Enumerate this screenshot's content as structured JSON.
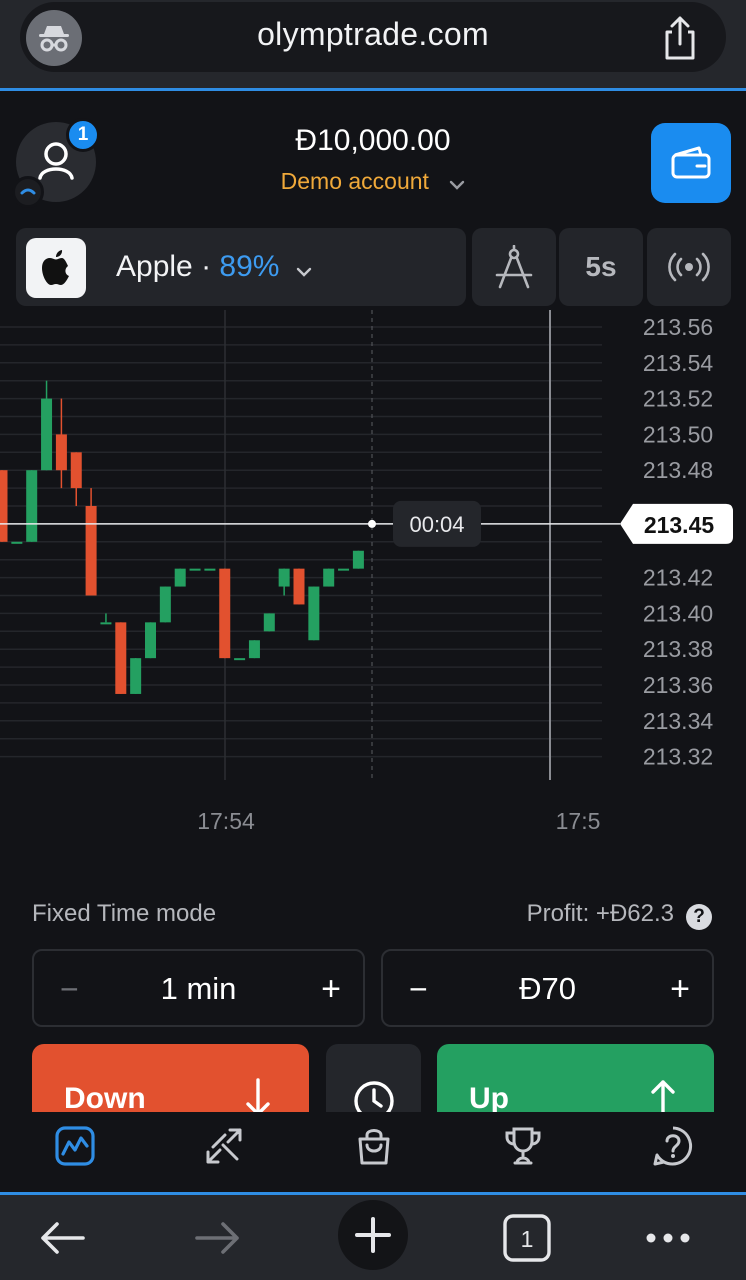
{
  "browser": {
    "url": "olymptrade.com",
    "tab_count": "1",
    "icons": {
      "incognito": "incognito-icon",
      "share": "share-icon",
      "back": "back-arrow-icon",
      "forward": "forward-arrow-icon",
      "new_tab": "plus-icon",
      "tabs": "tabs-icon",
      "more": "more-icon"
    }
  },
  "header": {
    "notification_count": "1",
    "balance": "Đ10,000.00",
    "account_label": "Demo account",
    "icons": {
      "avatar": "user-icon",
      "wallet": "wallet-icon",
      "dropdown": "chevron-down-icon"
    }
  },
  "asset": {
    "name": "Apple",
    "separator": " · ",
    "payout": "89%",
    "timeframe": "5s",
    "icons": {
      "logo": "apple-logo-icon",
      "draw": "compass-drawing-icon",
      "signals": "broadcast-icon"
    }
  },
  "chart_data": {
    "type": "candlestick",
    "price_axis_labels": [
      "213.56",
      "213.54",
      "213.52",
      "213.50",
      "213.48",
      "213.42",
      "213.40",
      "213.38",
      "213.36",
      "213.34",
      "213.32"
    ],
    "time_axis_labels": [
      "17:54",
      "17:5"
    ],
    "current_price": "213.45",
    "countdown": "00:04",
    "candles": [
      {
        "o": 213.48,
        "c": 213.44,
        "h": 213.48,
        "l": 213.44
      },
      {
        "o": 213.44,
        "c": 213.44,
        "h": 213.44,
        "l": 213.44
      },
      {
        "o": 213.44,
        "c": 213.48,
        "h": 213.48,
        "l": 213.44
      },
      {
        "o": 213.48,
        "c": 213.52,
        "h": 213.53,
        "l": 213.48
      },
      {
        "o": 213.5,
        "c": 213.48,
        "h": 213.52,
        "l": 213.47
      },
      {
        "o": 213.49,
        "c": 213.47,
        "h": 213.49,
        "l": 213.46
      },
      {
        "o": 213.46,
        "c": 213.41,
        "h": 213.47,
        "l": 213.41
      },
      {
        "o": 213.395,
        "c": 213.395,
        "h": 213.4,
        "l": 213.395
      },
      {
        "o": 213.395,
        "c": 213.355,
        "h": 213.395,
        "l": 213.355
      },
      {
        "o": 213.355,
        "c": 213.375,
        "h": 213.375,
        "l": 213.355
      },
      {
        "o": 213.375,
        "c": 213.395,
        "h": 213.395,
        "l": 213.375
      },
      {
        "o": 213.395,
        "c": 213.415,
        "h": 213.415,
        "l": 213.395
      },
      {
        "o": 213.415,
        "c": 213.425,
        "h": 213.425,
        "l": 213.415
      },
      {
        "o": 213.425,
        "c": 213.425,
        "h": 213.425,
        "l": 213.425
      },
      {
        "o": 213.425,
        "c": 213.425,
        "h": 213.425,
        "l": 213.425
      },
      {
        "o": 213.425,
        "c": 213.375,
        "h": 213.425,
        "l": 213.375
      },
      {
        "o": 213.375,
        "c": 213.375,
        "h": 213.375,
        "l": 213.375
      },
      {
        "o": 213.375,
        "c": 213.385,
        "h": 213.385,
        "l": 213.375
      },
      {
        "o": 213.39,
        "c": 213.4,
        "h": 213.4,
        "l": 213.39
      },
      {
        "o": 213.415,
        "c": 213.425,
        "h": 213.425,
        "l": 213.41
      },
      {
        "o": 213.425,
        "c": 213.405,
        "h": 213.425,
        "l": 213.405
      },
      {
        "o": 213.385,
        "c": 213.415,
        "h": 213.415,
        "l": 213.385
      },
      {
        "o": 213.415,
        "c": 213.425,
        "h": 213.425,
        "l": 213.415
      },
      {
        "o": 213.425,
        "c": 213.425,
        "h": 213.425,
        "l": 213.425
      },
      {
        "o": 213.425,
        "c": 213.435,
        "h": 213.435,
        "l": 213.425
      }
    ]
  },
  "trade": {
    "mode": "Fixed Time mode",
    "profit": "Profit: +Đ62.3",
    "help_label": "?",
    "duration": "1 min",
    "amount": "Đ70",
    "minus_label": "−",
    "plus_label": "+",
    "down_label": "Down",
    "up_label": "Up",
    "colors": {
      "down": "#e2512f",
      "up": "#24a061",
      "accent": "#1a8cf0"
    }
  },
  "app_nav": {
    "items": [
      "trading-chart-icon",
      "trades-arrows-icon",
      "market-bag-icon",
      "trophy-icon",
      "help-icon"
    ],
    "active": "trading-chart-icon"
  }
}
